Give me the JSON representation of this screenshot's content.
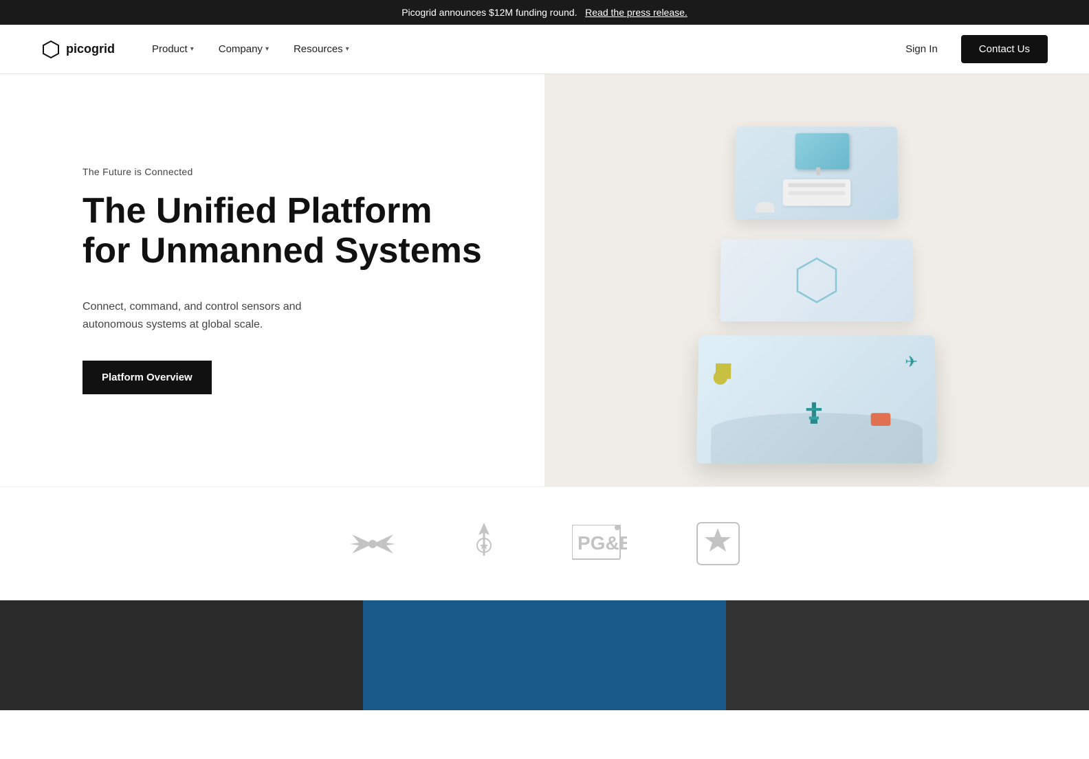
{
  "announcement": {
    "text": "Picogrid announces $12M funding round.",
    "link_text": "Read the press release.",
    "link_href": "#"
  },
  "nav": {
    "logo_text": "picogrid",
    "links": [
      {
        "label": "Product",
        "has_dropdown": true
      },
      {
        "label": "Company",
        "has_dropdown": true
      },
      {
        "label": "Resources",
        "has_dropdown": true
      }
    ],
    "sign_in_label": "Sign In",
    "contact_label": "Contact Us"
  },
  "hero": {
    "tagline": "The Future is Connected",
    "title": "The Unified Platform for Unmanned Systems",
    "description": "Connect, command, and control sensors and autonomous systems at global scale.",
    "cta_label": "Platform Overview"
  },
  "partners": [
    {
      "name": "US Air Force",
      "id": "usaf"
    },
    {
      "name": "US Space Force",
      "id": "ussf"
    },
    {
      "name": "PG&E",
      "id": "pge"
    },
    {
      "name": "US Army",
      "id": "usarmy"
    }
  ]
}
